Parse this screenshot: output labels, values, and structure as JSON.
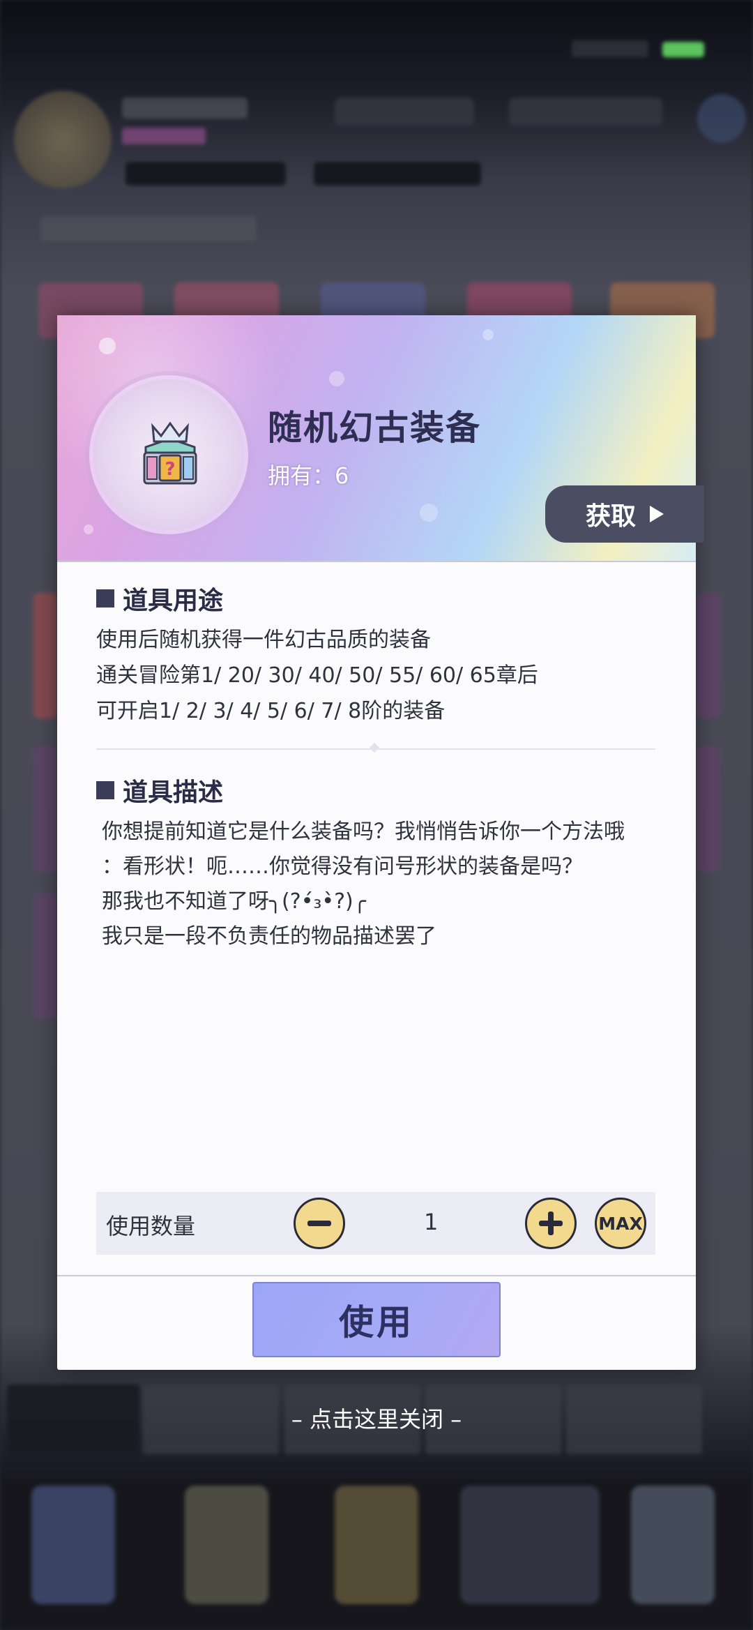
{
  "item": {
    "name": "随机幻古装备",
    "owned": "拥有：6",
    "obtain_label": "获取"
  },
  "usage": {
    "title": "道具用途",
    "lines": [
      "使用后随机获得一件幻古品质的装备",
      "通关冒险第1/ 20/ 30/ 40/ 50/ 55/ 60/ 65章后",
      "可开启1/ 2/ 3/ 4/ 5/ 6/ 7/ 8阶的装备"
    ]
  },
  "description": {
    "title": "道具描述",
    "lines": [
      "你想提前知道它是什么装备吗？我悄悄告诉你一个方法哦",
      "：看形状！呃……你觉得没有问号形状的装备是吗？",
      "那我也不知道了呀╮(?•́₃•̀?)╭",
      "我只是一段不负责任的物品描述罢了"
    ]
  },
  "quantity": {
    "label": "使用数量",
    "value": "1",
    "max_label": "MAX"
  },
  "use_label": "使用",
  "close_hint": "– 点击这里关闭 –"
}
